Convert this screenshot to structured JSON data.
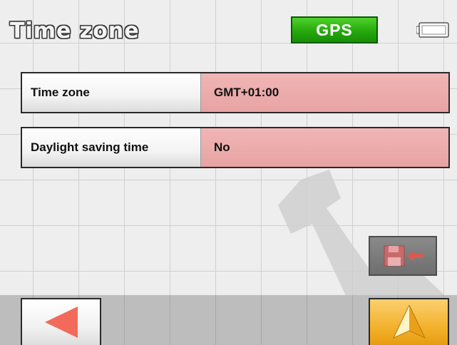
{
  "header": {
    "title": "Time zone",
    "gps_label": "GPS"
  },
  "settings": [
    {
      "label": "Time zone",
      "value": "GMT+01:00"
    },
    {
      "label": "Daylight saving time",
      "value": "No"
    }
  ],
  "icons": {
    "battery": "battery-icon",
    "save": "save-disk-icon",
    "back": "back-arrow-icon",
    "navigate": "navigation-arrow-icon",
    "watermark": "wrench-icon"
  },
  "colors": {
    "gps_badge": "#27a80e",
    "value_field": "#e8a3a3",
    "nav_button": "#f3b22e",
    "back_arrow": "#f26a5a"
  }
}
